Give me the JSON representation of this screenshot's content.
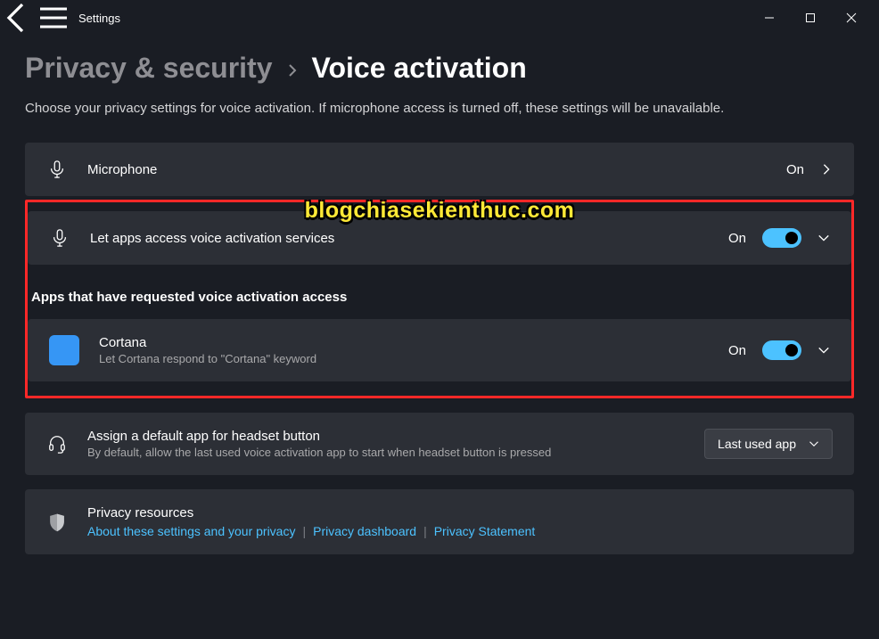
{
  "app": {
    "title": "Settings"
  },
  "breadcrumb": {
    "parent": "Privacy & security",
    "current": "Voice activation"
  },
  "page": {
    "description": "Choose your privacy settings for voice activation. If microphone access is turned off, these settings will be unavailable."
  },
  "microphone": {
    "label": "Microphone",
    "status": "On"
  },
  "voiceAccess": {
    "label": "Let apps access voice activation services",
    "status": "On"
  },
  "appsSection": {
    "heading": "Apps that have requested voice activation access"
  },
  "cortana": {
    "title": "Cortana",
    "sub": "Let Cortana respond to \"Cortana\" keyword",
    "status": "On"
  },
  "headset": {
    "title": "Assign a default app for headset button",
    "sub": "By default, allow the last used voice activation app to start when headset button is pressed",
    "selectLabel": "Last used app"
  },
  "resources": {
    "title": "Privacy resources",
    "links": [
      "About these settings and your privacy",
      "Privacy dashboard",
      "Privacy Statement"
    ]
  },
  "watermark": "blogchiasekienthuc.com"
}
